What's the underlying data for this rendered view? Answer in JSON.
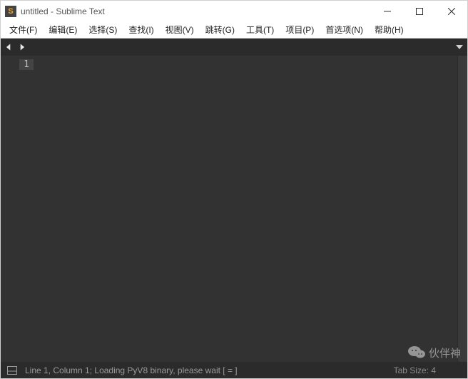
{
  "titlebar": {
    "title": "untitled - Sublime Text"
  },
  "menu": {
    "items": [
      "文件(F)",
      "编辑(E)",
      "选择(S)",
      "查找(I)",
      "视图(V)",
      "跳转(G)",
      "工具(T)",
      "项目(P)",
      "首选项(N)",
      "帮助(H)"
    ]
  },
  "editor": {
    "line_numbers": [
      "1"
    ]
  },
  "statusbar": {
    "left": "Line 1, Column 1; Loading PyV8 binary, please wait [ =     ]",
    "tab_size": "Tab Size: 4"
  },
  "watermark": {
    "text": "伙伴神"
  }
}
